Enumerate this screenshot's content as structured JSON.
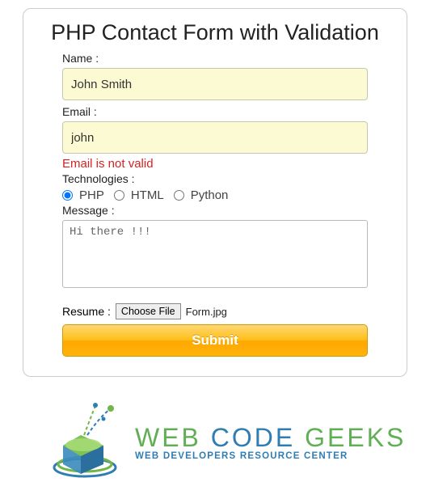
{
  "title": "PHP Contact Form with Validation",
  "fields": {
    "name": {
      "label": "Name :",
      "value": "John Smith"
    },
    "email": {
      "label": "Email :",
      "value": "john",
      "error": "Email is not valid"
    },
    "tech": {
      "label": "Technologies :",
      "options": [
        "PHP",
        "HTML",
        "Python"
      ],
      "selected": "PHP"
    },
    "message": {
      "label": "Message :",
      "value": "Hi there !!!"
    },
    "resume": {
      "label": "Resume :",
      "button": "Choose File",
      "filename": "Form.jpg"
    }
  },
  "submit": "Submit",
  "logo": {
    "word1": "WEB ",
    "word2": "CODE ",
    "word3": "GEEKS",
    "tagline": "WEB DEVELOPERS RESOURCE CENTER"
  }
}
